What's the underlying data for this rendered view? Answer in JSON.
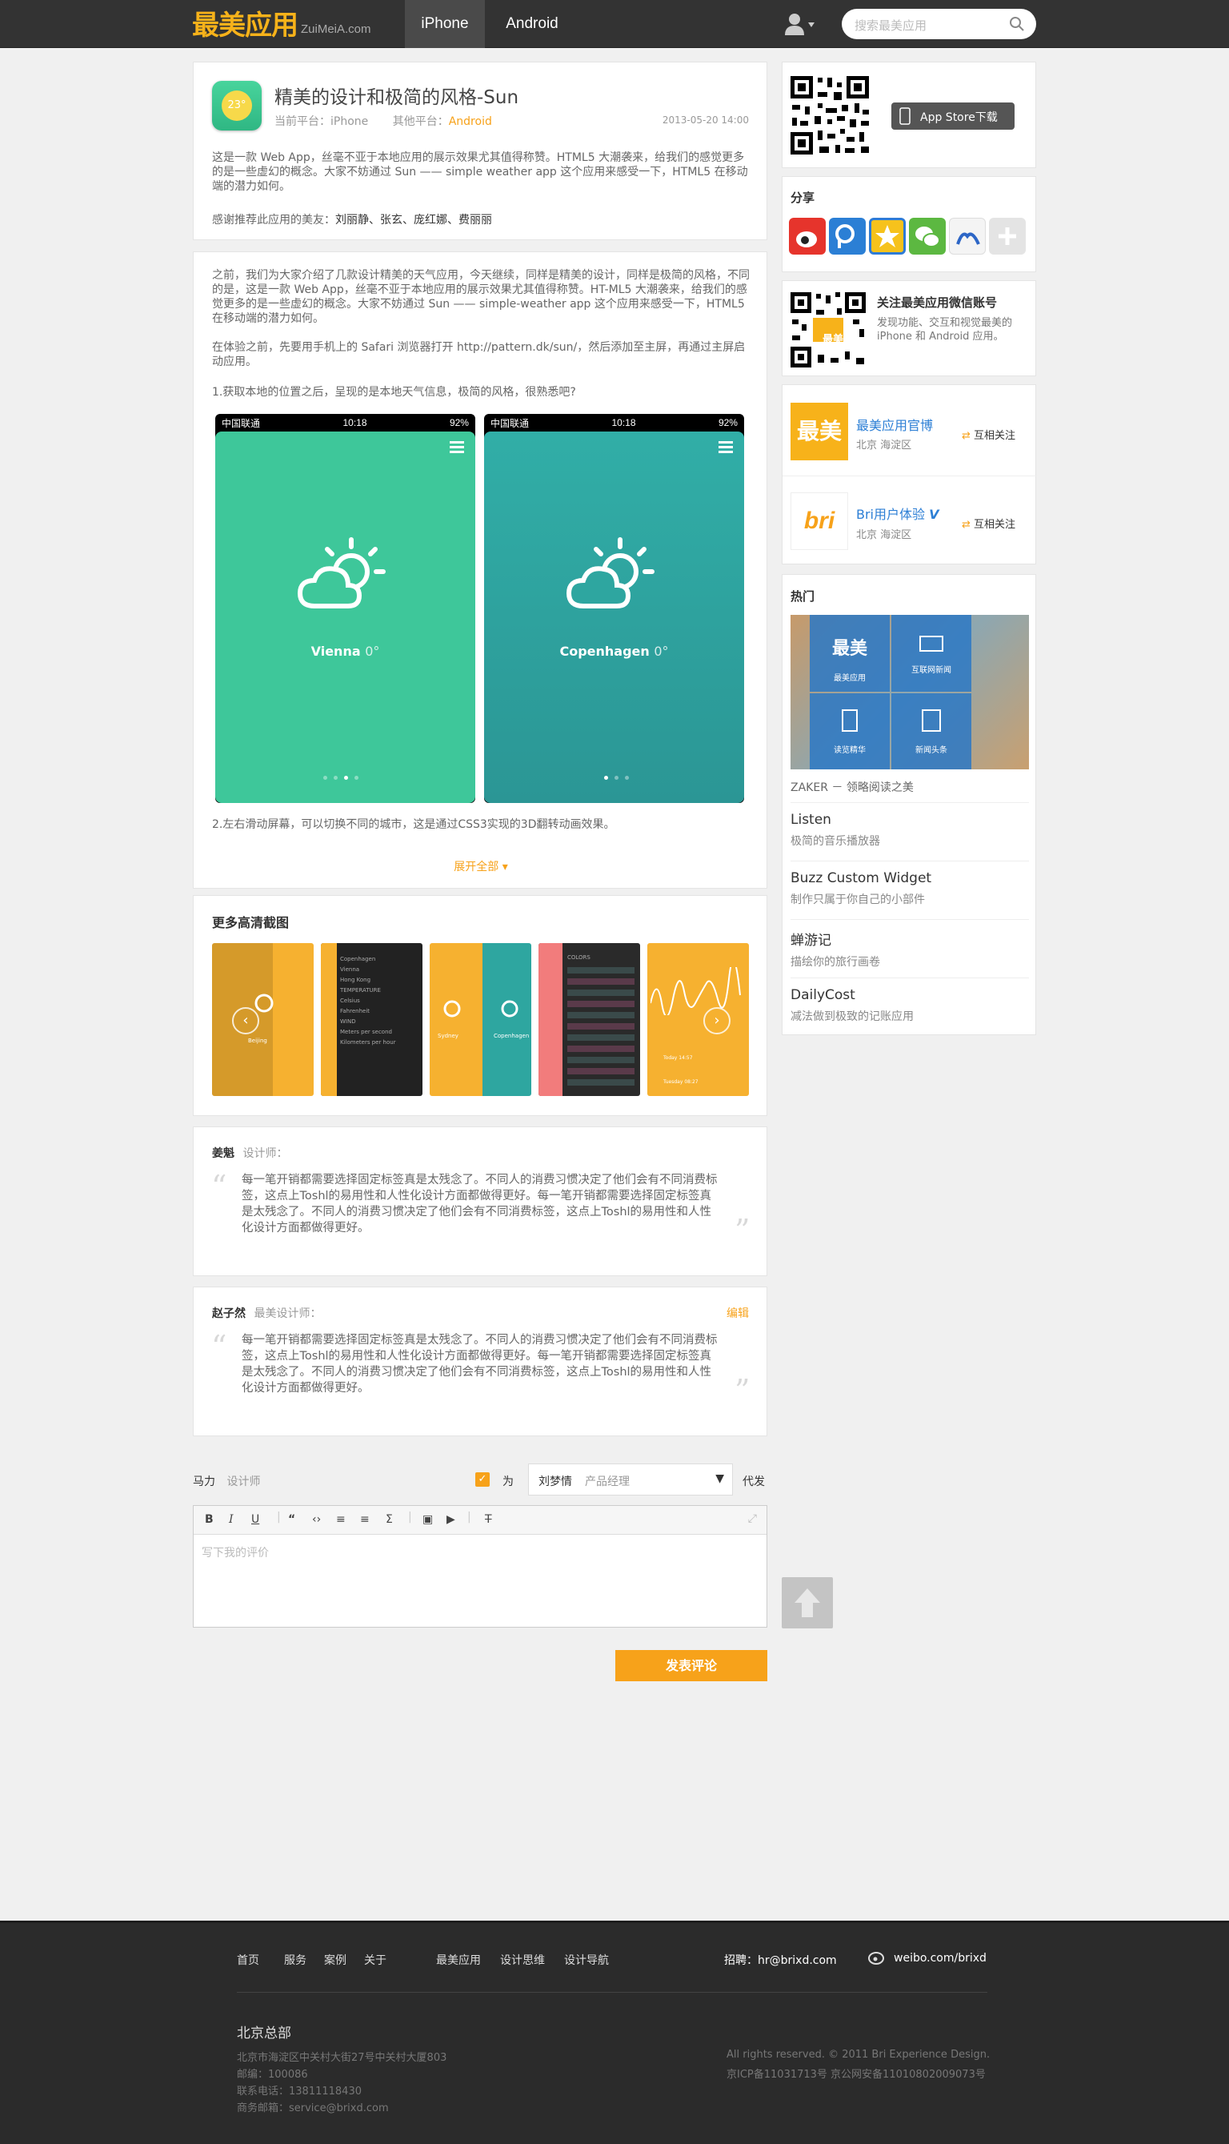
{
  "header": {
    "logo_cn": "最美应用",
    "logo_en": "ZuiMeiA.com",
    "tabs": [
      "iPhone",
      "Android"
    ],
    "search_placeholder": "搜索最美应用"
  },
  "app": {
    "icon_temp": "23°",
    "title": "精美的设计和极简的风格-Sun",
    "platform_label": "当前平台：iPhone",
    "other_label": "其他平台：",
    "other_value": "Android",
    "date": "2013-05-20  14:00",
    "desc": "这是一款 Web App，丝毫不亚于本地应用的展示效果尤其值得称赞。HTML5 大潮袭来，给我们的感觉更多的是一些虚幻的概念。大家不妨通过 Sun —— simple weather app 这个应用来感受一下，HTML5 在移动端的潜力如何。",
    "thanks_label": "感谢推荐此应用的美友：",
    "thanks_names": "刘丽静、张玄、庞红娜、费丽丽"
  },
  "article": {
    "p1": "之前，我们为大家介绍了几款设计精美的天气应用，今天继续，同样是精美的设计，同样是极简的风格，不同的是，这是一款 Web App，丝毫不亚于本地应用的展示效果尤其值得称赞。HT-ML5 大潮袭来，给我们的感觉更多的是一些虚幻的概念。大家不妨通过 Sun —— simple-weather app 这个应用来感受一下，HTML5 在移动端的潜力如何。",
    "p2": "在体验之前，先要用手机上的 Safari 浏览器打开 http://pattern.dk/sun/，然后添加至主屏，再通过主屏启动应用。",
    "p3": "1.获取本地的位置之后，呈现的是本地天气信息，极简的风格，很熟悉吧?",
    "phones": [
      {
        "carrier": "中国联通",
        "time": "10:18",
        "battery": "92%",
        "city": "Vienna",
        "temp": "0°",
        "color": "#3ec79a"
      },
      {
        "carrier": "中国联通",
        "time": "10:18",
        "battery": "92%",
        "city": "Copenhagen",
        "temp": "0°",
        "color": "#2da59f"
      }
    ],
    "p4": "2.左右滑动屏幕，可以切换不同的城市，这是通过CSS3实现的3D翻转动画效果。",
    "expand": "展开全部"
  },
  "screens": {
    "title": "更多高清截图",
    "thumbs": [
      {
        "city": "Beijing",
        "lines": [
          "Copenhagen",
          "Vienna",
          "Hong Kong",
          "TEMPERATURE",
          "Celsius",
          "Fahrenheit",
          "WIND",
          "Meters per second",
          "Kilometers per hour"
        ],
        "colors": [
          "COLORS"
        ],
        "right": [
          "Sydney",
          "Copenhagen"
        ],
        "times": [
          "Today 14:57",
          "Tuesday 08:27"
        ]
      }
    ]
  },
  "comments": [
    {
      "name": "姜魁",
      "role": "设计师：",
      "edit": "",
      "text": "每一笔开销都需要选择固定标签真是太残念了。不同人的消费习惯决定了他们会有不同消费标签，这点上Toshl的易用性和人性化设计方面都做得更好。每一笔开销都需要选择固定标签真是太残念了。不同人的消费习惯决定了他们会有不同消费标签，这点上Toshl的易用性和人性化设计方面都做得更好。"
    },
    {
      "name": "赵子然",
      "role": "最美设计师：",
      "edit": "编辑",
      "text": "每一笔开销都需要选择固定标签真是太残念了。不同人的消费习惯决定了他们会有不同消费标签，这点上Toshl的易用性和人性化设计方面都做得更好。每一笔开销都需要选择固定标签真是太残念了。不同人的消费习惯决定了他们会有不同消费标签，这点上Toshl的易用性和人性化设计方面都做得更好。"
    }
  ],
  "compose": {
    "name": "马力",
    "role": "设计师",
    "for_label": "为",
    "select_name": "刘梦情",
    "select_role": "产品经理",
    "proxy_label": "代发",
    "placeholder": "写下我的评价",
    "submit": "发表评论"
  },
  "sidebar": {
    "appstore": "App Store下载",
    "share_title": "分享",
    "wechat_title": "关注最美应用微信账号",
    "wechat_desc": "发现功能、交互和视觉最美的 iPhone 和 Android 应用。",
    "qr_badge": "最美",
    "follows": [
      {
        "logo": "最美",
        "name": "最美应用官博",
        "loc": "北京 海淀区",
        "action": "互相关注",
        "logo_bg": "#f7b21a"
      },
      {
        "logo": "bri",
        "name": "Bri用户体验",
        "loc": "北京 海淀区",
        "action": "互相关注",
        "logo_bg": "#ffffff"
      }
    ],
    "hot_title": "热门",
    "zaker_tiles": [
      "最美应用",
      "互联网新闻",
      "读览精华",
      "新闻头条"
    ],
    "zaker_big": "最美",
    "zaker_label": "ZAKER － 领略阅读之美",
    "hot": [
      {
        "t": "Listen",
        "d": "极简的音乐播放器"
      },
      {
        "t": "Buzz Custom Widget",
        "d": "制作只属于你自己的小部件"
      },
      {
        "t": "蝉游记",
        "d": "描绘你的旅行画卷"
      },
      {
        "t": "DailyCost",
        "d": "减法做到极致的记账应用"
      }
    ]
  },
  "footer": {
    "links": [
      "首页",
      "服务",
      "案例",
      "关于",
      "最美应用",
      "设计思维",
      "设计导航"
    ],
    "hire": "招聘：hr@brixd.com",
    "weibo": "weibo.com/brixd",
    "hq": "北京总部",
    "address": [
      "北京市海淀区中关村大街27号中关村大厦803",
      "邮编：100086",
      "联系电话：13811118430",
      "商务邮箱：service@brixd.com"
    ],
    "copyright": "All rights reserved. © 2011 Bri Experience Design.",
    "icp": "京ICP备11031713号 京公网安备11010802009073号"
  }
}
